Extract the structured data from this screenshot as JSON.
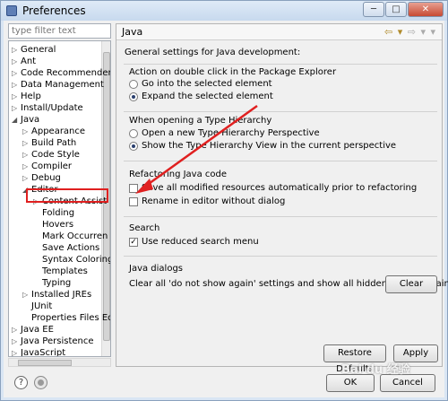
{
  "window": {
    "title": "Preferences"
  },
  "filter": {
    "placeholder": "type filter text"
  },
  "tree": {
    "items": [
      {
        "label": "General",
        "twisty": "▷",
        "indent": 0
      },
      {
        "label": "Ant",
        "twisty": "▷",
        "indent": 0
      },
      {
        "label": "Code Recommenders",
        "twisty": "▷",
        "indent": 0
      },
      {
        "label": "Data Management",
        "twisty": "▷",
        "indent": 0
      },
      {
        "label": "Help",
        "twisty": "▷",
        "indent": 0
      },
      {
        "label": "Install/Update",
        "twisty": "▷",
        "indent": 0
      },
      {
        "label": "Java",
        "twisty": "◢",
        "indent": 0
      },
      {
        "label": "Appearance",
        "twisty": "▷",
        "indent": 1
      },
      {
        "label": "Build Path",
        "twisty": "▷",
        "indent": 1
      },
      {
        "label": "Code Style",
        "twisty": "▷",
        "indent": 1
      },
      {
        "label": "Compiler",
        "twisty": "▷",
        "indent": 1
      },
      {
        "label": "Debug",
        "twisty": "▷",
        "indent": 1
      },
      {
        "label": "Editor",
        "twisty": "◢",
        "indent": 1
      },
      {
        "label": "Content Assist",
        "twisty": "▷",
        "indent": 2
      },
      {
        "label": "Folding",
        "twisty": "",
        "indent": 2
      },
      {
        "label": "Hovers",
        "twisty": "",
        "indent": 2
      },
      {
        "label": "Mark Occurren",
        "twisty": "",
        "indent": 2
      },
      {
        "label": "Save Actions",
        "twisty": "",
        "indent": 2
      },
      {
        "label": "Syntax Coloring",
        "twisty": "",
        "indent": 2
      },
      {
        "label": "Templates",
        "twisty": "",
        "indent": 2
      },
      {
        "label": "Typing",
        "twisty": "",
        "indent": 2
      },
      {
        "label": "Installed JREs",
        "twisty": "▷",
        "indent": 1
      },
      {
        "label": "JUnit",
        "twisty": "",
        "indent": 1
      },
      {
        "label": "Properties Files Ed",
        "twisty": "",
        "indent": 1
      },
      {
        "label": "Java EE",
        "twisty": "▷",
        "indent": 0
      },
      {
        "label": "Java Persistence",
        "twisty": "▷",
        "indent": 0
      },
      {
        "label": "JavaScript",
        "twisty": "▷",
        "indent": 0
      }
    ]
  },
  "page": {
    "title": "Java",
    "description": "General settings for Java development:",
    "nav_back": "⇦",
    "nav_forward": "⇨",
    "nav_menu": "▾"
  },
  "section_double_click": {
    "title": "Action on double click in the Package Explorer",
    "option1": "Go into the selected element",
    "option2": "Expand the selected element"
  },
  "section_hierarchy": {
    "title": "When opening a Type Hierarchy",
    "option1": "Open a new Type Hierarchy Perspective",
    "option2": "Show the Type Hierarchy View in the current perspective"
  },
  "section_refactoring": {
    "title": "Refactoring Java code",
    "option1": "Save all modified resources automatically prior to refactoring",
    "option2": "Rename in editor without dialog"
  },
  "section_search": {
    "title": "Search",
    "option1": "Use reduced search menu"
  },
  "section_dialogs": {
    "title": "Java dialogs",
    "text": "Clear all 'do not show again' settings and show all hidden dialogs again",
    "clear_button": "Clear"
  },
  "buttons": {
    "restore_defaults": "Restore Defaults",
    "apply": "Apply",
    "ok": "OK",
    "cancel": "Cancel"
  },
  "icons": {
    "help": "?",
    "minimize": "─",
    "maximize": "□",
    "close": "✕"
  },
  "watermark": "Bai du 经验",
  "colors": {
    "annotation_red": "#e02020",
    "selection_blue": "#2a3f6e"
  }
}
